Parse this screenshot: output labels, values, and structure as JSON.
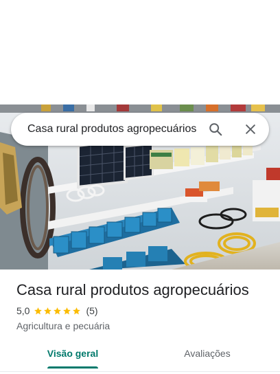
{
  "search": {
    "query": "Casa rural produtos agropecuários",
    "search_icon": "search-icon",
    "close_icon": "close-icon"
  },
  "photo": {
    "subject": "store-shelves-photo"
  },
  "place": {
    "title": "Casa rural produtos agropecuários",
    "rating_value": "5,0",
    "rating": 5,
    "review_count": "(5)",
    "category": "Agricultura e pecuária"
  },
  "tabs": [
    {
      "label": "Visão geral",
      "selected": true
    },
    {
      "label": "Avaliações",
      "selected": false
    }
  ],
  "colors": {
    "accent": "#00796b",
    "star": "#fbbc04",
    "text_primary": "#202124",
    "text_secondary": "#5f6368"
  }
}
